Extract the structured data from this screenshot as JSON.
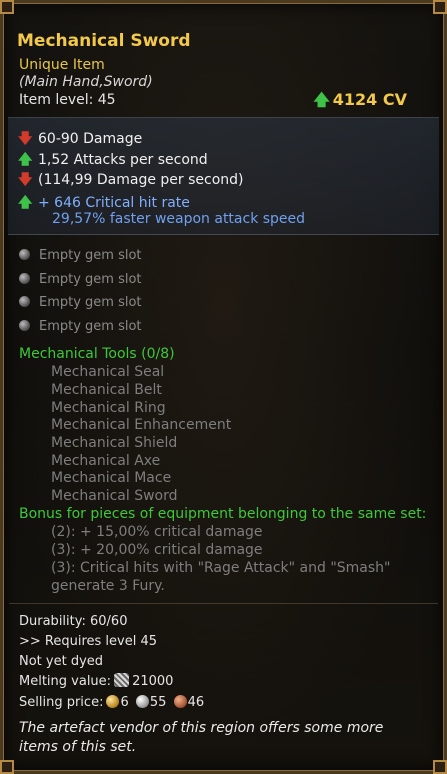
{
  "item": {
    "name": "Mechanical Sword",
    "rarity": "Unique Item",
    "slot": "(Main Hand,Sword)",
    "item_level": "Item level: 45",
    "cv": "4124 CV"
  },
  "stats": [
    {
      "text": "60-90 Damage",
      "indicator": "down"
    },
    {
      "text": "1,52 Attacks per second",
      "indicator": "up"
    },
    {
      "text": "(114,99 Damage per second)",
      "indicator": "down"
    },
    {
      "text": "+ 646 Critical hit rate",
      "indicator": "up"
    },
    {
      "text": "29,57% faster weapon attack speed",
      "indicator": "none"
    }
  ],
  "gem_slots": [
    "Empty gem slot",
    "Empty gem slot",
    "Empty gem slot",
    "Empty gem slot"
  ],
  "set": {
    "title": "Mechanical Tools (0/8)",
    "items": [
      "Mechanical Seal",
      "Mechanical Belt",
      "Mechanical Ring",
      "Mechanical Enhancement",
      "Mechanical Shield",
      "Mechanical Axe",
      "Mechanical Mace",
      "Mechanical Sword"
    ],
    "bonus_title": "Bonus for pieces of equipment belonging to the same set:",
    "bonuses": [
      "(2): + 15,00% critical damage",
      "(3): + 20,00% critical damage",
      "(3): Critical hits with \"Rage Attack\" and \"Smash\"",
      "generate 3 Fury."
    ]
  },
  "footer": {
    "durability": "Durability: 60/60",
    "requires": ">> Requires level 45",
    "dyed": "Not yet dyed",
    "melting_label": "Melting value:",
    "melting_value": "21000",
    "selling_label": "Selling price:",
    "gold": "6",
    "silver": "55",
    "copper": "46",
    "note_line1": "The artefact vendor of this region offers some more",
    "note_line2": "items of this set."
  },
  "colors": {
    "title": "#f2c94a",
    "set_green": "#3ec83a",
    "stat_blue": "#7fb0ff",
    "arrow_up": "#3fc24a",
    "arrow_down": "#d23a2a"
  },
  "icons": {
    "up": "up-arrow-icon",
    "down": "down-arrow-icon",
    "gem": "gem-slot-icon",
    "ore": "ore-icon",
    "gold": "gold-coin-icon",
    "silver": "silver-coin-icon",
    "copper": "copper-coin-icon"
  }
}
